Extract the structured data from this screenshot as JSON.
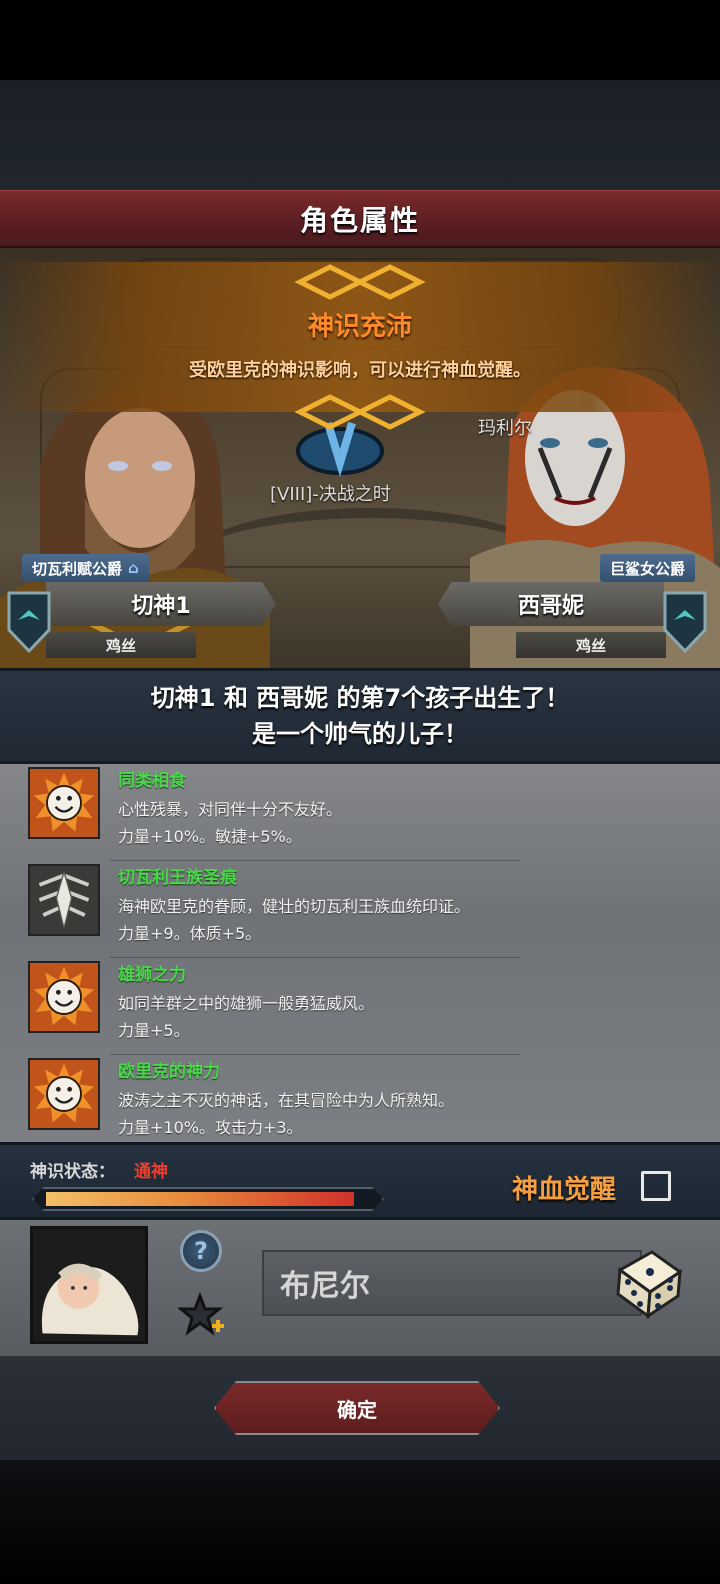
{
  "header": {
    "title": "角色属性"
  },
  "banner": {
    "title": "神识充沛",
    "description": "受欧里克的神识影响，可以进行神血觉醒。"
  },
  "scene": {
    "map_label": "[VIII]-决战之时",
    "right_place_partial": "玛利尔"
  },
  "parents": {
    "father": {
      "title": "切瓦利赋公爵",
      "name": "切神1",
      "rank": "鸡丝"
    },
    "mother": {
      "title": "巨鲨女公爵",
      "name": "西哥妮",
      "rank": "鸡丝"
    }
  },
  "announcement": {
    "line1": "切神1 和 西哥妮 的第7个孩子出生了！",
    "line2": "是一个帅气的儿子！"
  },
  "traits": [
    {
      "name": "同类相食",
      "description": "心性残暴，对同伴十分不友好。",
      "stats": "力量+10%。敏捷+5%。",
      "icon": "smiley-sun-icon"
    },
    {
      "name": "切瓦利王族圣痕",
      "description": "海神欧里克的眷顾，健壮的切瓦利王族血统印证。",
      "stats": "力量+9。体质+5。",
      "icon": "crest-icon"
    },
    {
      "name": "雄狮之力",
      "description": "如同羊群之中的雄狮一般勇猛威风。",
      "stats": "力量+5。",
      "icon": "smiley-sun-icon"
    },
    {
      "name": "欧里克的神力",
      "description": "波涛之主不灭的神话，在其冒险中为人所熟知。",
      "stats": "力量+10%。攻击力+3。",
      "icon": "smiley-sun-icon"
    }
  ],
  "status": {
    "label": "神识状态：",
    "value": "通神",
    "progress": 0.95,
    "awaken_label": "神血觉醒",
    "awaken_checked": false
  },
  "child": {
    "name": "布尼尔",
    "help_symbol": "?"
  },
  "footer": {
    "confirm_label": "确定"
  },
  "colors": {
    "accent_orange": "#ff8a2a",
    "trait_green": "#4cd64c",
    "status_red": "#e84030",
    "title_red": "#7a2a2a"
  }
}
